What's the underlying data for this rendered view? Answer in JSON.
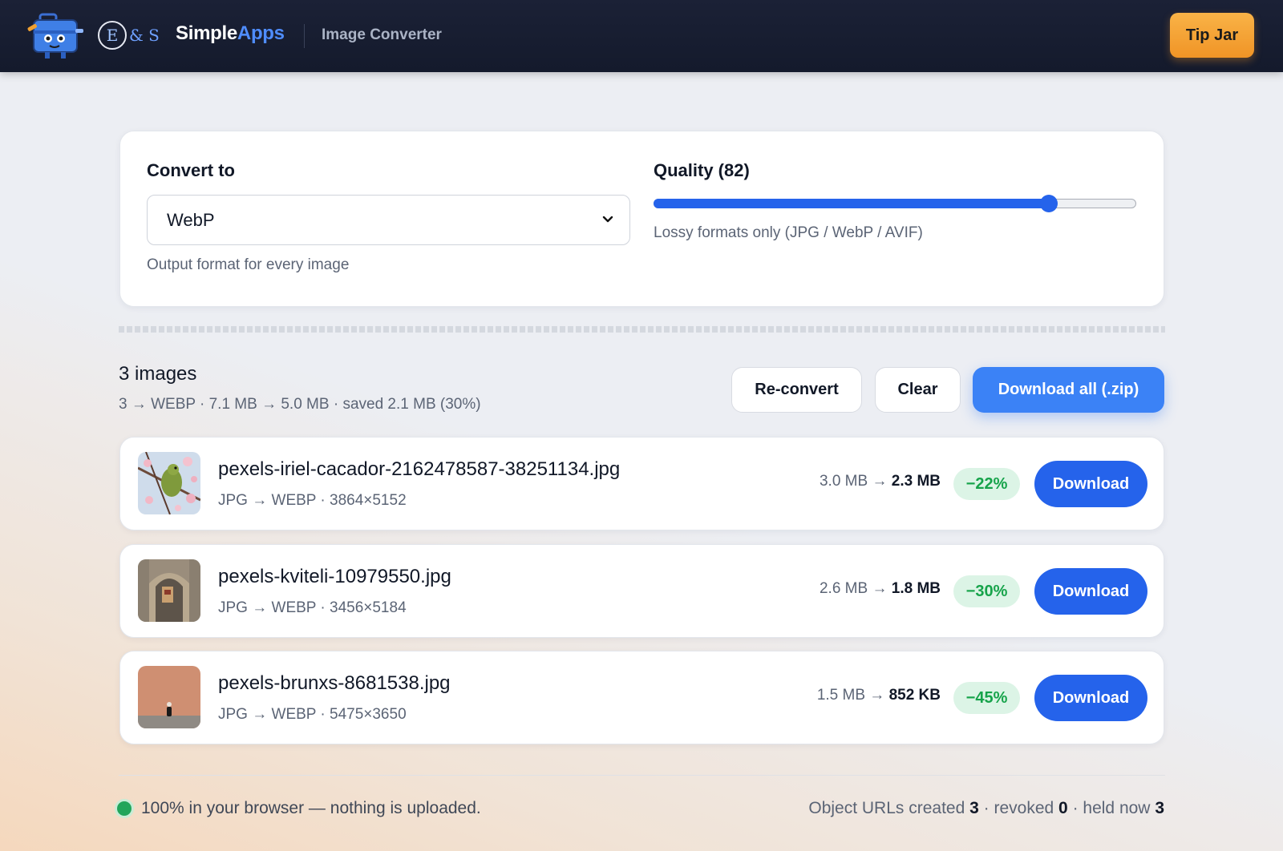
{
  "header": {
    "logo_mark": "E",
    "logo_rest": "& S",
    "brand_primary": "Simple",
    "brand_accent": "Apps",
    "app_name": "Image Converter",
    "tip_jar_label": "Tip Jar",
    "colors": {
      "bar": "#161c2f",
      "accent": "#4f8dff",
      "tip_jar": "#f5a337"
    }
  },
  "settings": {
    "convert_to_label": "Convert to",
    "format_value": "WebP",
    "format_hint": "Output format for every image",
    "quality_label": "Quality (82)",
    "quality_value": 82,
    "quality_range": [
      1,
      100
    ],
    "quality_hint": "Lossy formats only (JPG / WebP / AVIF)"
  },
  "batch": {
    "count_label": "3 images",
    "summary": "3 → WEBP · 7.1 MB → 5.0 MB · saved 2.1 MB (30%)",
    "reconvert_label": "Re-convert",
    "clear_label": "Clear",
    "download_all_label": "Download all (.zip)"
  },
  "files": [
    {
      "name": "pexels-iriel-cacador-2162478587-38251134.jpg",
      "meta": "JPG → WEBP · 3864×5152",
      "size_from": "3.0 MB →",
      "size_to": "2.3 MB",
      "saving": "−22%",
      "download_label": "Download",
      "thumbnail": "bird-on-blossom-branch"
    },
    {
      "name": "pexels-kviteli-10979550.jpg",
      "meta": "JPG → WEBP · 3456×5184",
      "size_from": "2.6 MB →",
      "size_to": "1.8 MB",
      "saving": "−30%",
      "download_label": "Download",
      "thumbnail": "stone-archway-door"
    },
    {
      "name": "pexels-brunxs-8681538.jpg",
      "meta": "JPG → WEBP · 5475×3650",
      "size_from": "1.5 MB →",
      "size_to": "852 KB",
      "saving": "−45%",
      "download_label": "Download",
      "thumbnail": "person-before-pink-wall"
    }
  ],
  "footer": {
    "privacy_text": "100% in your browser — nothing is uploaded.",
    "urls_created_label": "Object URLs created",
    "urls_created": "3",
    "urls_revoked_label": "· revoked",
    "urls_revoked": "0",
    "urls_held_label": "· held now",
    "urls_held": "3"
  }
}
